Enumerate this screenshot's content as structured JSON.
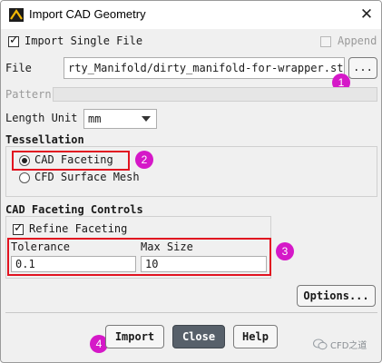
{
  "window": {
    "title": "Import CAD Geometry",
    "close_glyph": "✕"
  },
  "import_single_file": {
    "label": "Import Single File",
    "checked": true
  },
  "append": {
    "label": "Append",
    "checked": false,
    "enabled": false
  },
  "file": {
    "label": "File",
    "value": "rty_Manifold/dirty_manifold-for-wrapper.stp",
    "browse_label": "..."
  },
  "pattern": {
    "label": "Pattern",
    "value": "",
    "enabled": false
  },
  "length_unit": {
    "label": "Length Unit",
    "value": "mm"
  },
  "tessellation": {
    "heading": "Tessellation",
    "options": [
      {
        "label": "CAD Faceting",
        "selected": true
      },
      {
        "label": "CFD Surface Mesh",
        "selected": false
      }
    ]
  },
  "cad_faceting_controls": {
    "heading": "CAD Faceting Controls",
    "refine_faceting": {
      "label": "Refine Faceting",
      "checked": true
    },
    "tolerance": {
      "label": "Tolerance",
      "value": "0.1"
    },
    "max_size": {
      "label": "Max Size",
      "value": "10"
    }
  },
  "options_button": "Options...",
  "buttons": {
    "import": "Import",
    "close": "Close",
    "help": "Help"
  },
  "callouts": [
    "1",
    "2",
    "3",
    "4"
  ],
  "watermark": {
    "text": "CFD之道"
  },
  "colors": {
    "callout": "#d518c8",
    "highlight_box": "#e11320",
    "close_button": "#57606a"
  }
}
